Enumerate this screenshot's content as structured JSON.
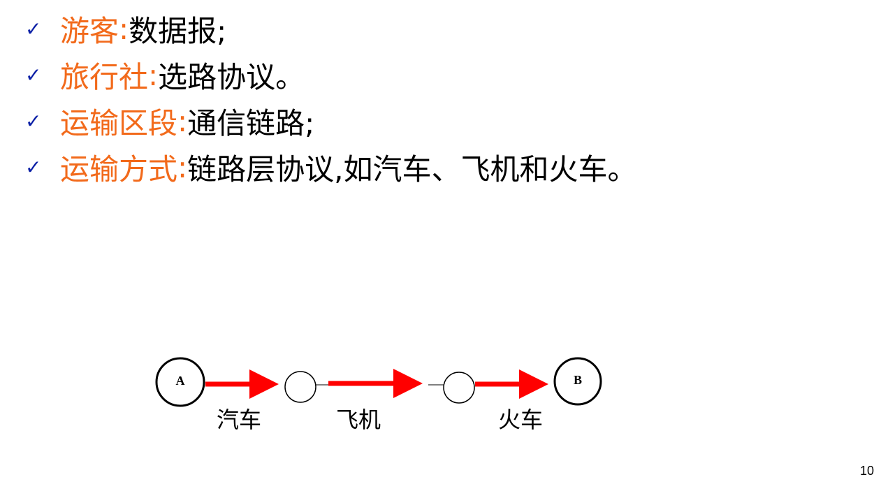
{
  "bullets": [
    {
      "term": "游客",
      "colon": ":",
      "desc": "数据报;"
    },
    {
      "term": "旅行社",
      "colon": ":",
      "desc": "选路协议。"
    },
    {
      "term": "运输区段",
      "colon": ":",
      "desc": "通信链路;"
    },
    {
      "term": "运输方式",
      "colon": ":",
      "desc": "链路层协议,如汽车、飞机和火车。"
    }
  ],
  "check_icon": "checkmark-icon",
  "diagram": {
    "nodes": [
      {
        "label": "A"
      },
      {
        "label": ""
      },
      {
        "label": ""
      },
      {
        "label": "B"
      }
    ],
    "links": [
      {
        "label": "汽车"
      },
      {
        "label": "飞机"
      },
      {
        "label": "火车"
      }
    ]
  },
  "colors": {
    "term": "#f26a1b",
    "check": "#0b1fa6",
    "arrow": "#ff0000"
  },
  "page_number": "10"
}
